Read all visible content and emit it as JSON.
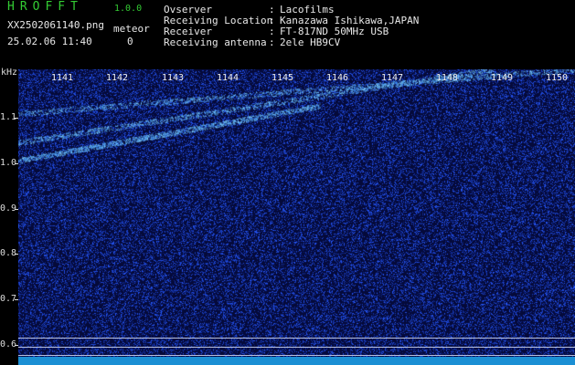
{
  "app": {
    "title": "HROFFT",
    "version": "1.0.0"
  },
  "capture": {
    "filename": "XX2502061140.png",
    "timestamp": "25.02.06 11:40",
    "meteor_label": "meteor",
    "meteor_count": "0"
  },
  "info": [
    {
      "label": "Ovserver",
      "value": "Lacofilms"
    },
    {
      "label": "Receiving Location",
      "value": "Kanazawa Ishikawa,JAPAN"
    },
    {
      "label": "Receiver",
      "value": "FT-817ND 50MHz USB"
    },
    {
      "label": "Receiving antenna",
      "value": "2ele HB9CV"
    }
  ],
  "chart_data": {
    "type": "heatmap",
    "yunit": "kHz",
    "ylim": [
      0.585,
      1.17
    ],
    "yticks": [
      "1.1",
      "1.0",
      "0.9",
      "0.8",
      "0.7",
      "0.6"
    ],
    "xticks": [
      "1141",
      "1142",
      "1143",
      "1144",
      "1145",
      "1146",
      "1147",
      "1148",
      "1149",
      "1150"
    ],
    "colors": {
      "background": "#050a3a",
      "signal": "#7fd0ff",
      "noise": "#2a4bd0"
    }
  }
}
